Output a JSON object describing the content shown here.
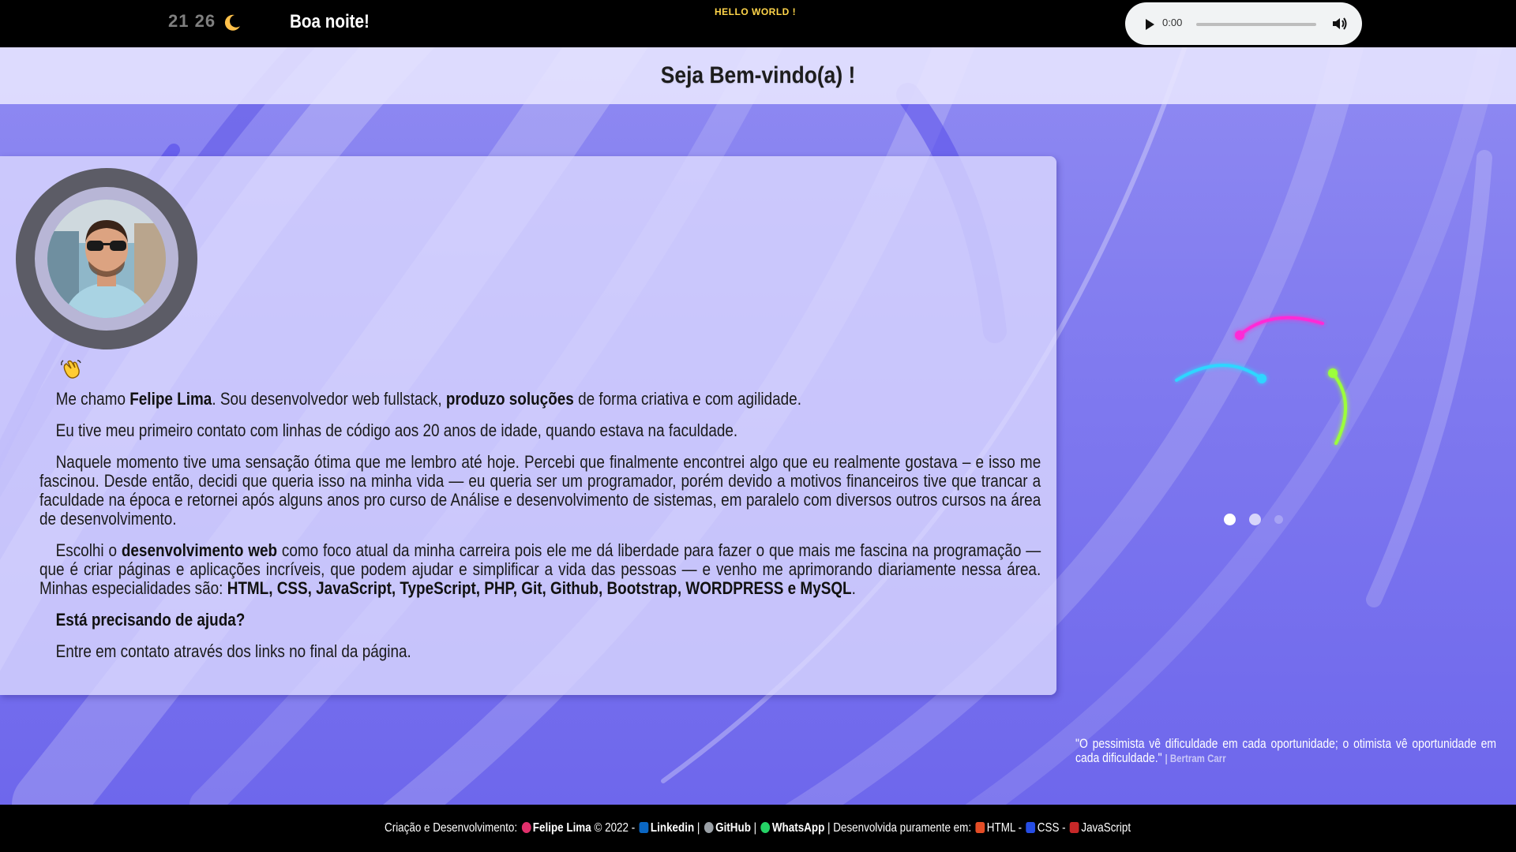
{
  "header": {
    "time": "21 26",
    "greeting": "Boa noite!",
    "hello": "HELLO WORLD !",
    "audio": {
      "time": "0:00",
      "progress": 0
    }
  },
  "welcome": {
    "title": "Seja Bem-vindo(a) !"
  },
  "bio": {
    "p1": {
      "t1": "Me chamo ",
      "b1": "Felipe Lima",
      "t2": ". Sou desenvolvedor web fullstack, ",
      "b2": "produzo soluções",
      "t3": " de forma criativa e com agilidade."
    },
    "p2": "Eu tive meu primeiro contato com linhas de código aos 20 anos de idade, quando estava na faculdade.",
    "p3": "Naquele momento tive uma sensação ótima que me lembro até hoje. Percebi que finalmente encontrei algo que eu realmente gostava – e isso me fascinou. Desde então, decidi que queria isso na minha vida — eu queria ser um programador, porém devido a motivos financeiros tive que trancar a faculdade na época e retornei após alguns anos pro curso de Análise e desenvolvimento de sistemas, em paralelo com diversos outros cursos na área de desenvolvimento.",
    "p4": {
      "t1": "Escolhi o ",
      "b1": "desenvolvimento web",
      "t2": " como foco atual da minha carreira pois ele me dá liberdade para fazer o que mais me fascina na programação — que é criar páginas e aplicações incríveis, que podem ajudar e simplificar a vida das pessoas — e venho me aprimorando diariamente nessa área. Minhas especialidades são: ",
      "b2": "HTML, CSS, JavaScript, TypeScript, PHP, Git, Github, Bootstrap, WORDPRESS e MySQL",
      "t3": "."
    },
    "p5": "Está precisando de ajuda?",
    "p6": "Entre em contato através dos links no final da página."
  },
  "quote": {
    "text": "\"O pessimista vê dificuldade em cada oportunidade; o otimista vê oportunidade em cada dificuldade.\"",
    "author": "| Bertram Carr"
  },
  "carousel": {
    "dots": 3,
    "active": 0
  },
  "colors": {
    "loader_magenta": "#ff2bd6",
    "loader_cyan": "#2fd6ff",
    "loader_green": "#9cff3a"
  },
  "footer": {
    "creation_label": "Criação e Desenvolvimento:",
    "author": "Felipe Lima",
    "copyright": "© 2022 -",
    "linkedin": "Linkedin",
    "sep1": "|",
    "github": "GitHub",
    "sep2": "|",
    "whatsapp": "WhatsApp",
    "built_with": "| Desenvolvida puramente em:",
    "html": "HTML",
    "dash1": "-",
    "css": "CSS",
    "dash2": "-",
    "js": "JavaScript"
  }
}
